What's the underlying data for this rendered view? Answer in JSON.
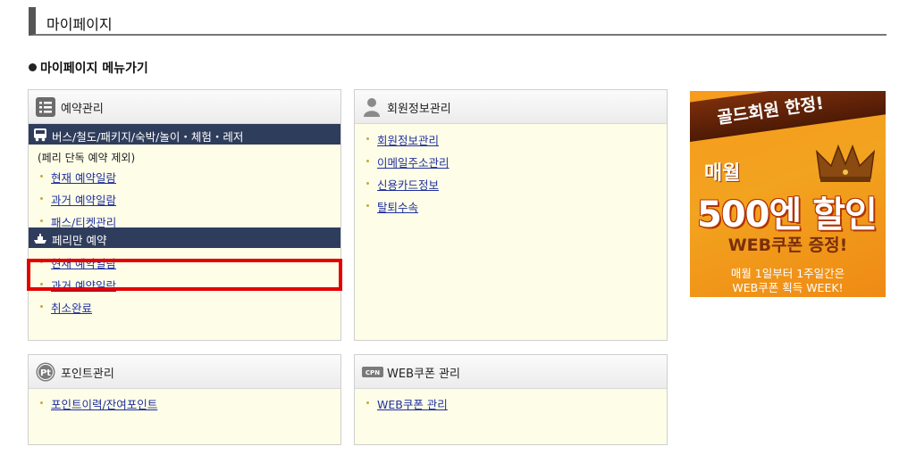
{
  "page": {
    "title": "마이페이지",
    "menu_heading": "마이페이지 메뉴가기"
  },
  "reservation": {
    "title": "예약관리",
    "sections": [
      {
        "heading": "버스/철도/패키지/숙박/놀이・체험・레저",
        "note": "(페리 단독 예약 제외)",
        "links": [
          "현재 예약일람",
          "과거 예약일람",
          "패스/티켓관리"
        ]
      },
      {
        "heading": "페리만 예약",
        "links": [
          "현재 예약일람",
          "과거 예약일람",
          "취소완료"
        ]
      }
    ]
  },
  "member": {
    "title": "회원정보관리",
    "links": [
      "회원정보관리",
      "이메일주소관리",
      "신용카드정보",
      "탈퇴수속"
    ]
  },
  "points": {
    "title": "포인트관리",
    "icon_text": "Pt",
    "links": [
      "포인트이력/잔여포인트"
    ]
  },
  "webcoupon": {
    "title": "WEB쿠폰 관리",
    "icon_text": "CPN",
    "links": [
      "WEB쿠폰 관리"
    ]
  },
  "promo": {
    "ribbon": "골드회원 한정!",
    "monthly": "매월",
    "discount": "500엔 할인",
    "coupon": "WEB쿠폰 증정!",
    "line1": "매월 1일부터 1주일간은",
    "line2": "WEB쿠폰 획득 WEEK!"
  },
  "colors": {
    "subhead_bg": "#2f3d5c",
    "box_bg": "#fefee8",
    "link": "#1f2f9e",
    "highlight": "#e30000",
    "promo_orange": "#f79b1e"
  }
}
